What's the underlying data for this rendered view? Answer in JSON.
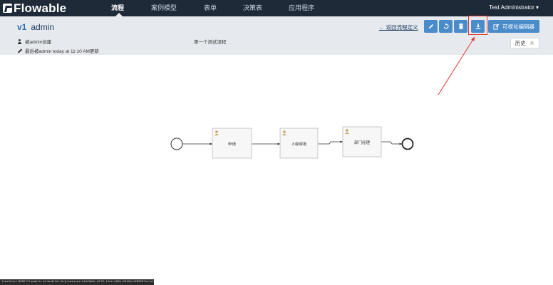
{
  "app": {
    "logo_text": "Flowable",
    "nav": [
      {
        "label": "流程",
        "active": true
      },
      {
        "label": "案例模型",
        "active": false
      },
      {
        "label": "表单",
        "active": false
      },
      {
        "label": "决策表",
        "active": false
      },
      {
        "label": "应用程序",
        "active": false
      }
    ],
    "user_menu": "Test Administrator ▾"
  },
  "header": {
    "version": "v1",
    "name": "admin",
    "created_by": "被admin创建",
    "updated_by": "最后被admin  today at 11:10 AM更新",
    "description": "第一个测试流程",
    "back_link": "← 返回流程定义",
    "toolbar": {
      "edit_icon": "pencil-icon",
      "copy_icon": "copy-icon",
      "delete_icon": "trash-icon",
      "download_icon": "download-icon"
    },
    "visual_editor_label": "可视化编辑器",
    "history_label": "历史",
    "history_count": "1"
  },
  "diagram": {
    "tasks": [
      {
        "label": "申请"
      },
      {
        "label": "上级审批"
      },
      {
        "label": "部门经理"
      }
    ],
    "task_icon": "user-icon",
    "start_event": "start-event",
    "end_event": "end-event"
  },
  "colors": {
    "topbar": "#1e2a38",
    "header_bg": "#e6eaee",
    "button_blue": "#4a8bc9",
    "annotation_red": "#e0372f"
  },
  "status_bar": {
    "url": "localhost:8080/flowable-ui/modeler/#/processes/e4af8a6c-8f70-11ee-b86e-0242ac120002?version=1701402851023"
  }
}
